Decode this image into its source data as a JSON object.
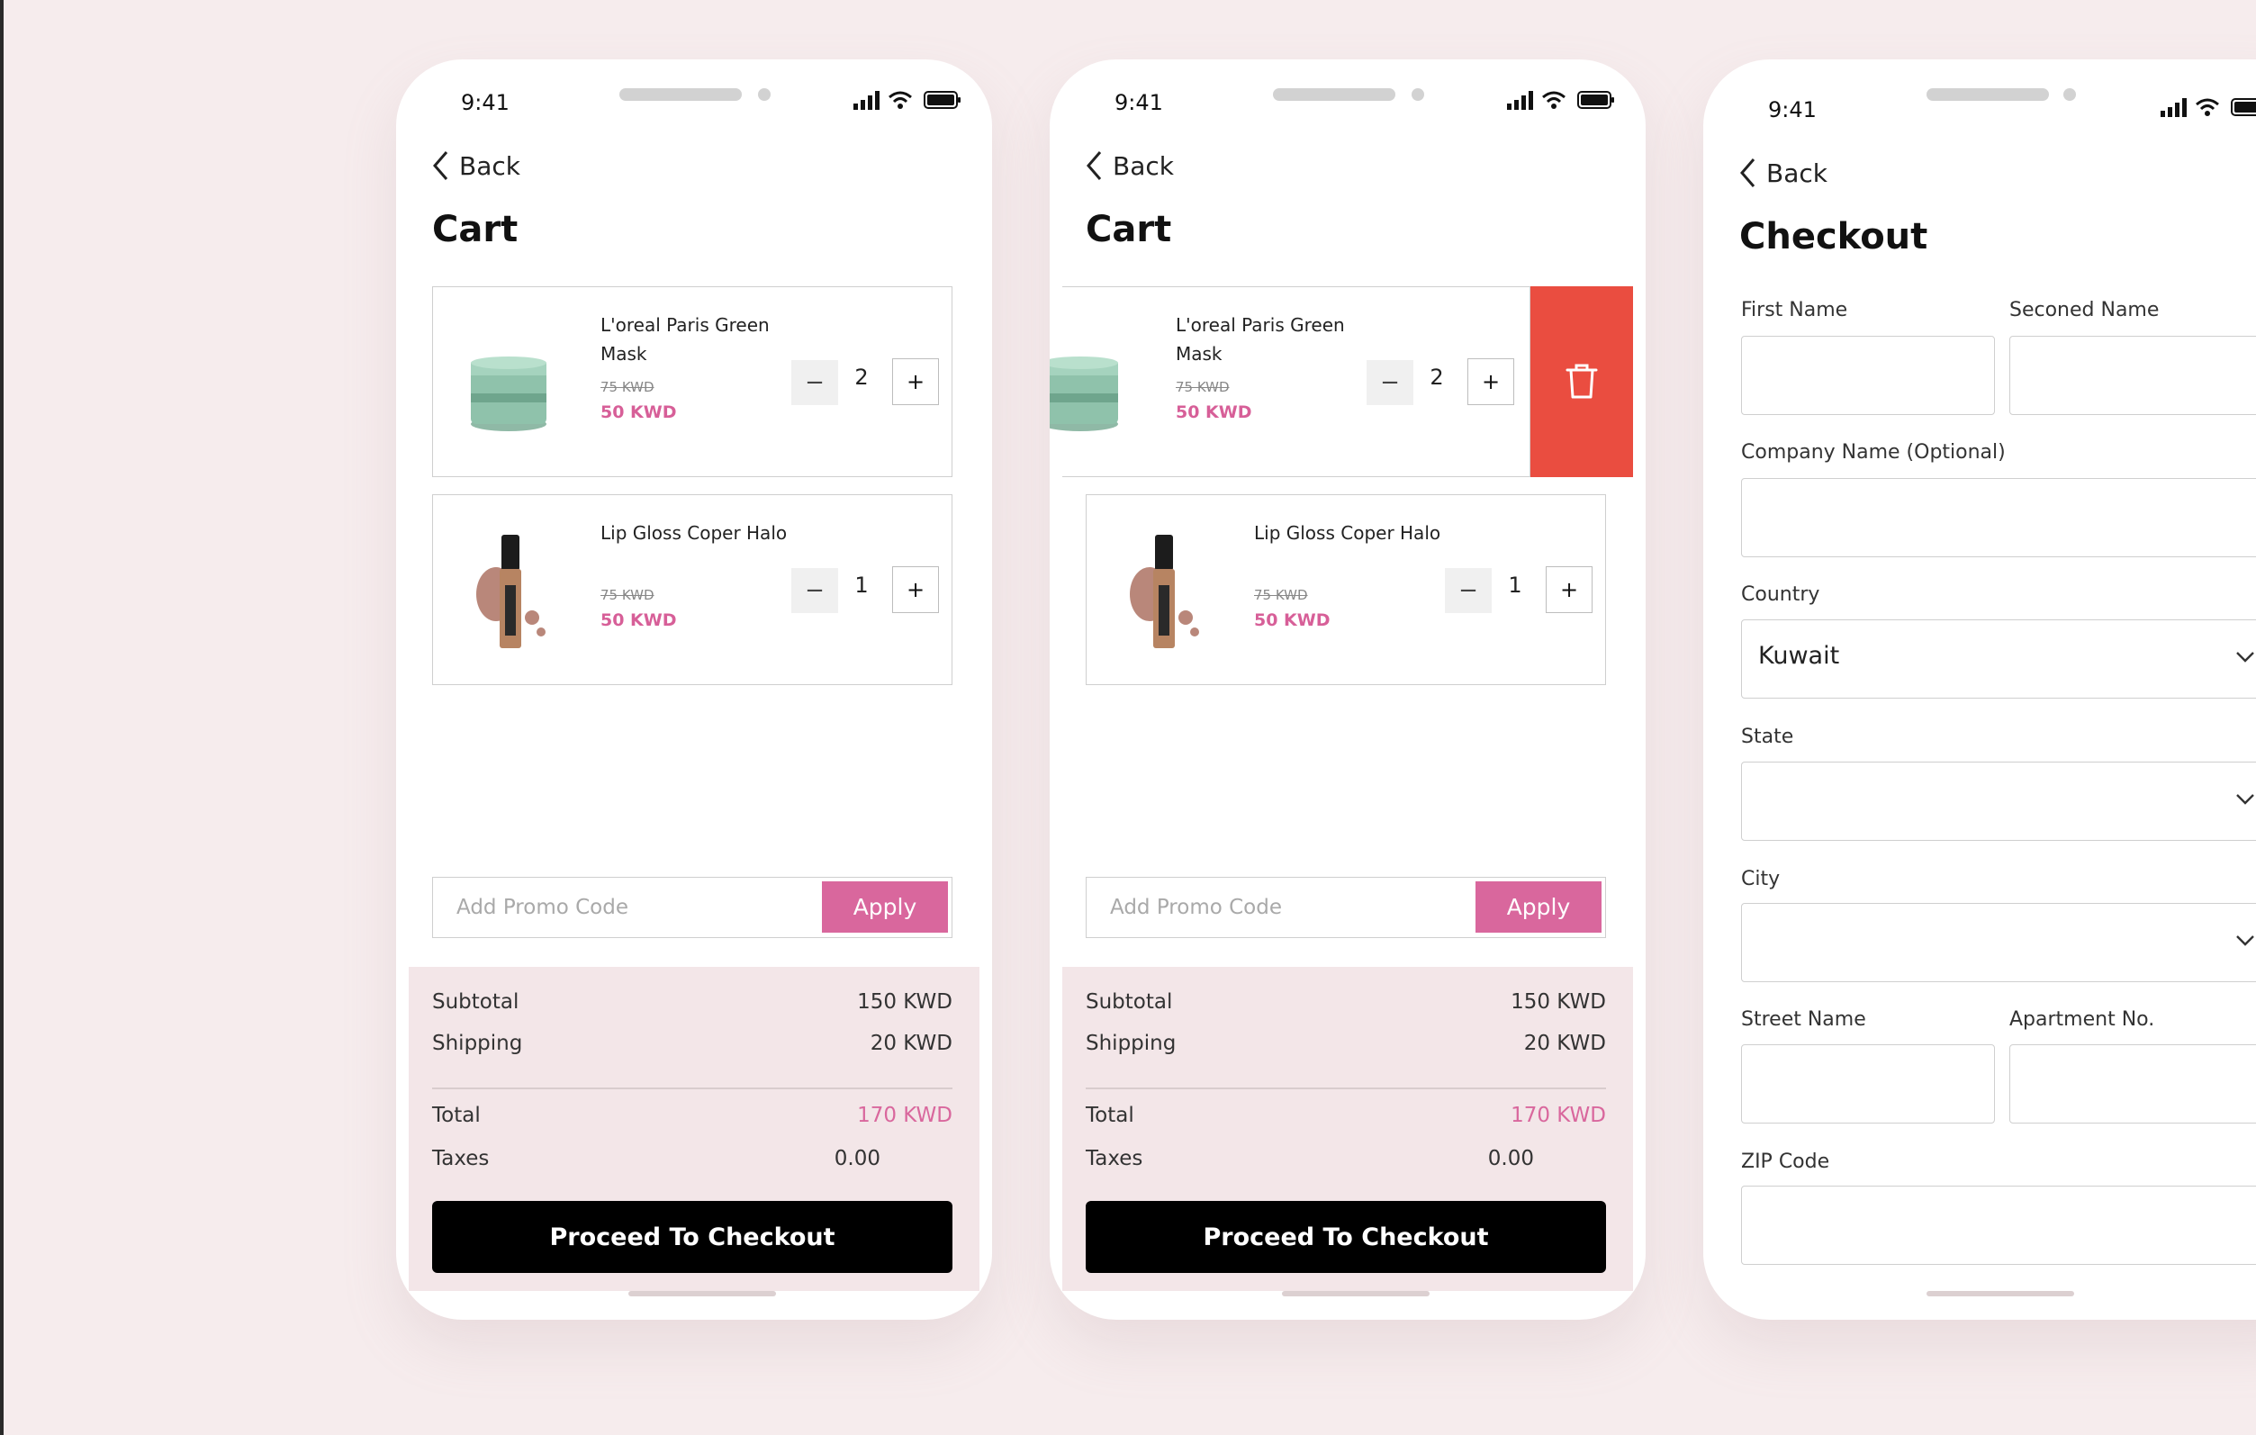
{
  "status": {
    "time": "9:41"
  },
  "cart": {
    "back_label": "Back",
    "title": "Cart",
    "items": [
      {
        "name": "L'oreal Paris Green Mask",
        "old_price": "75 KWD",
        "price": "50 KWD",
        "qty": "2"
      },
      {
        "name": "Lip Gloss Coper Halo",
        "old_price": "75 KWD",
        "price": "50 KWD",
        "qty": "1"
      }
    ],
    "minus_label": "−",
    "plus_label": "+",
    "promo_placeholder": "Add Promo Code",
    "apply_label": "Apply",
    "summary": {
      "subtotal_label": "Subtotal",
      "subtotal": "150 KWD",
      "shipping_label": "Shipping",
      "shipping": "20 KWD",
      "total_label": "Total",
      "total": "170 KWD",
      "taxes_label": "Taxes",
      "taxes": "0.00"
    },
    "checkout_label": "Proceed To Checkout"
  },
  "checkout": {
    "back_label": "Back",
    "title": "Checkout",
    "first_name_label": "First Name",
    "second_name_label": "Seconed Name",
    "company_label": "Company Name (Optional)",
    "country_label": "Country",
    "country_value": "Kuwait",
    "state_label": "State",
    "city_label": "City",
    "street_label": "Street Name",
    "apartment_label": "Apartment No.",
    "zip_label": "ZIP Code"
  },
  "colors": {
    "accent": "#d9679d",
    "price": "#d75f98",
    "delete": "#ea4d40",
    "background": "#f6eced",
    "summary_bg": "#f3e6e8"
  },
  "icons": [
    "back-chevron-icon",
    "signal-icon",
    "wifi-icon",
    "battery-icon",
    "trash-icon",
    "chevron-down-icon"
  ]
}
